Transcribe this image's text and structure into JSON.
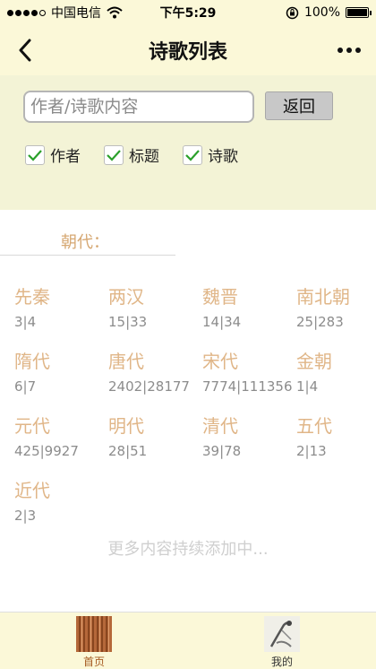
{
  "status_bar": {
    "carrier": "中国电信",
    "time": "下午5:29",
    "battery_text": "100%",
    "battery_level": 1.0
  },
  "nav": {
    "title": "诗歌列表"
  },
  "search": {
    "placeholder": "作者/诗歌内容",
    "back_label": "返回"
  },
  "filters": [
    {
      "label": "作者",
      "checked": true
    },
    {
      "label": "标题",
      "checked": true
    },
    {
      "label": "诗歌",
      "checked": true
    }
  ],
  "dynasty_section": {
    "header": "朝代：",
    "items": [
      {
        "name": "先秦",
        "count": "3|4"
      },
      {
        "name": "两汉",
        "count": "15|33"
      },
      {
        "name": "魏晋",
        "count": "14|34"
      },
      {
        "name": "南北朝",
        "count": "25|283"
      },
      {
        "name": "隋代",
        "count": "6|7"
      },
      {
        "name": "唐代",
        "count": "2402|28177"
      },
      {
        "name": "宋代",
        "count": "7774|111356"
      },
      {
        "name": "金朝",
        "count": "1|4"
      },
      {
        "name": "元代",
        "count": "425|9927"
      },
      {
        "name": "明代",
        "count": "28|51"
      },
      {
        "name": "清代",
        "count": "39|78"
      },
      {
        "name": "五代",
        "count": "2|13"
      },
      {
        "name": "近代",
        "count": "2|3"
      }
    ],
    "more_text": "更多内容持续添加中..."
  },
  "tabs": [
    {
      "label": "首页",
      "icon": "home-icon",
      "active": true
    },
    {
      "label": "我的",
      "icon": "profile-icon",
      "active": false
    }
  ],
  "colors": {
    "header_bg": "#fbf8d8",
    "search_bg": "#f3f3d6",
    "dynasty_name": "#e0b688",
    "dynasty_count": "#8c8c8c",
    "check_green": "#2aa02a",
    "tab_active": "#a65b22"
  }
}
